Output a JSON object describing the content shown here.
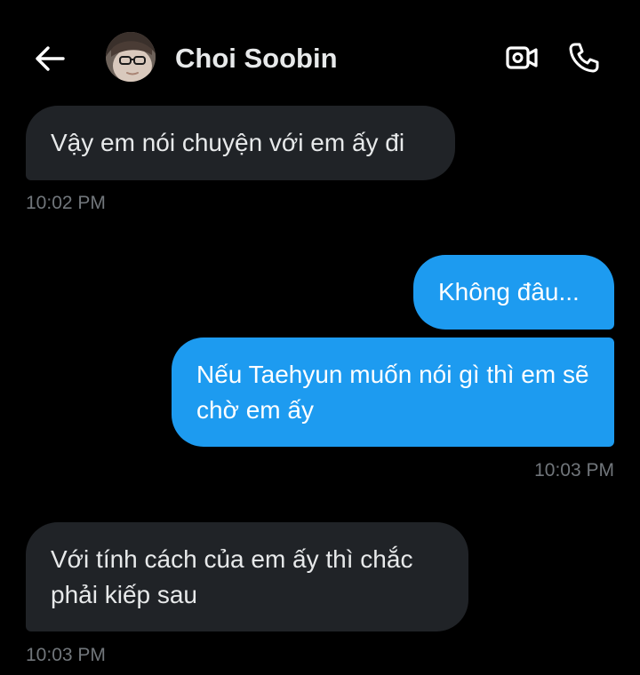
{
  "header": {
    "back_icon": "arrow-left-icon",
    "contact_name": "Choi Soobin",
    "video_icon": "video-camera-icon",
    "call_icon": "phone-icon"
  },
  "messages": [
    {
      "direction": "received",
      "text": "Vậy em nói chuyện với em ấy đi",
      "time": "10:02 PM"
    },
    {
      "direction": "sent",
      "text": "Không đâu...",
      "time": ""
    },
    {
      "direction": "sent",
      "text": "Nếu Taehyun muốn nói gì thì em sẽ chờ em ấy",
      "time": "10:03 PM"
    },
    {
      "direction": "received",
      "text": "Với tính cách của em ấy thì chắc phải kiếp sau",
      "time": "10:03 PM"
    }
  ],
  "colors": {
    "background": "#000000",
    "received_bubble": "#202327",
    "sent_bubble": "#1d9bf0",
    "primary_text": "#e7e9ea",
    "muted_text": "#71767b"
  }
}
